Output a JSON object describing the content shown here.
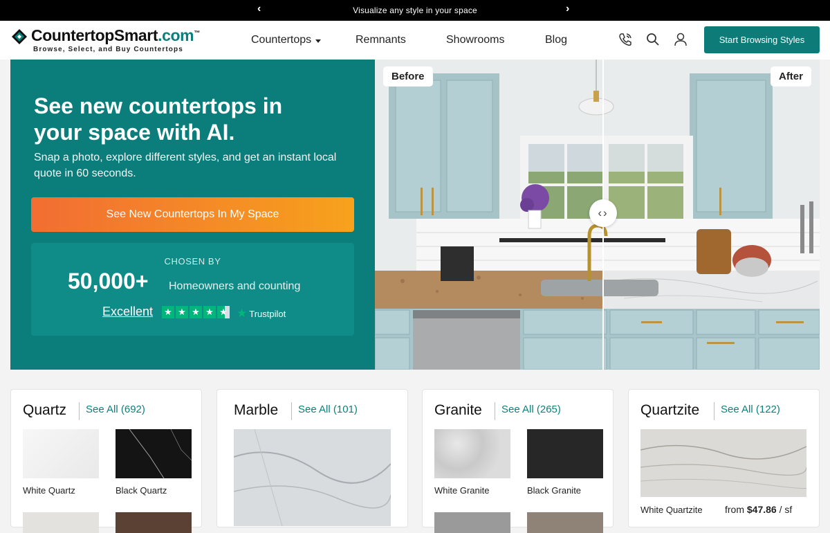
{
  "announcement": {
    "message": "Visualize any style in your space"
  },
  "logo": {
    "name": "CountertopSmart",
    "domain": ".com",
    "tm": "™",
    "tagline": "Browse, Select, and Buy Countertops"
  },
  "nav": {
    "countertops": "Countertops",
    "remnants": "Remnants",
    "showrooms": "Showrooms",
    "blog": "Blog"
  },
  "header_cta": "Start Browsing Styles",
  "hero": {
    "title": "See new countertops in your space with AI.",
    "subtitle": "Snap a photo, explore different styles, and get an instant local quote in 60 seconds.",
    "cta": "See New Countertops In My Space",
    "chosen_label": "CHOSEN BY",
    "count": "50,000+",
    "count_sub": "Homeowners and counting",
    "rating_text": "Excellent",
    "rating_stars": 4.5,
    "trustpilot": "Trustpilot",
    "before_label": "Before",
    "after_label": "After"
  },
  "categories": [
    {
      "title": "Quartz",
      "see_all": "See All (692)",
      "items": [
        "White Quartz",
        "Black Quartz"
      ]
    },
    {
      "title": "Marble",
      "see_all": "See All (101)",
      "items": []
    },
    {
      "title": "Granite",
      "see_all": "See All (265)",
      "items": [
        "White Granite",
        "Black Granite"
      ]
    },
    {
      "title": "Quartzite",
      "see_all": "See All (122)",
      "items": [
        "White Quartzite"
      ],
      "price_prefix": "from",
      "price": "$47.86",
      "price_unit": "/ sf"
    }
  ],
  "colors": {
    "brand_teal": "#0b7d7a",
    "cta_orange": "#f26d33",
    "cta_amber": "#f7a21c",
    "trustpilot_green": "#00b67a"
  }
}
